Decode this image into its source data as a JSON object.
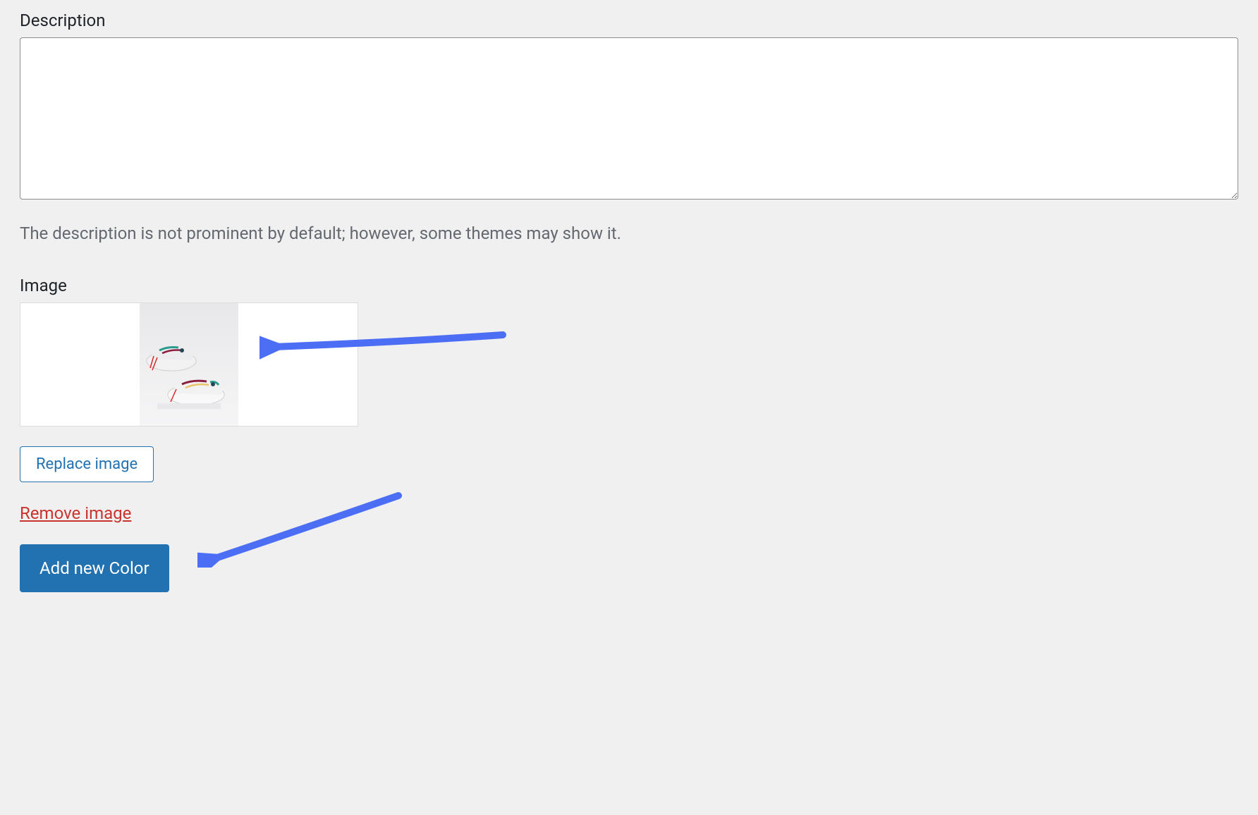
{
  "description": {
    "label": "Description",
    "value": "",
    "help_text": "The description is not prominent by default; however, some themes may show it."
  },
  "image": {
    "label": "Image",
    "replace_button_label": "Replace image",
    "remove_link_label": "Remove image",
    "alt": "product-sneaker-image"
  },
  "add_button_label": "Add new Color",
  "colors": {
    "primary_blue": "#2271b1",
    "danger_red": "#c9352e",
    "arrow_blue": "#4c6ef5"
  }
}
